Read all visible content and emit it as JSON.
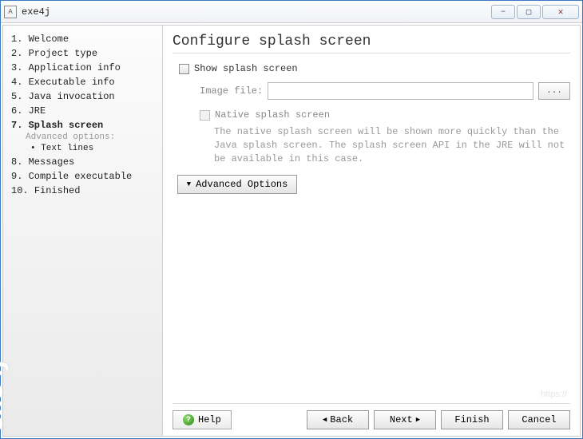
{
  "window": {
    "title": "exe4j",
    "brand": "exe4j"
  },
  "titlebar_buttons": {
    "min": "–",
    "max": "▢",
    "close": "✕"
  },
  "sidebar": {
    "items": [
      {
        "num": "1.",
        "label": "Welcome"
      },
      {
        "num": "2.",
        "label": "Project type"
      },
      {
        "num": "3.",
        "label": "Application info"
      },
      {
        "num": "4.",
        "label": "Executable info"
      },
      {
        "num": "5.",
        "label": "Java invocation"
      },
      {
        "num": "6.",
        "label": "JRE"
      },
      {
        "num": "7.",
        "label": "Splash screen",
        "current": true
      },
      {
        "num": "8.",
        "label": "Messages"
      },
      {
        "num": "9.",
        "label": "Compile executable"
      },
      {
        "num": "10.",
        "label": "Finished"
      }
    ],
    "advanced_label": "Advanced options:",
    "sub_item": "• Text lines"
  },
  "main": {
    "title": "Configure splash screen",
    "show_splash_label": "Show splash screen",
    "image_file_label": "Image file:",
    "browse_label": "...",
    "native_label": "Native splash screen",
    "native_desc": "The native splash screen will be shown more quickly than the Java splash screen. The splash screen API in the JRE will not be available in this case.",
    "advanced_btn": "Advanced Options"
  },
  "footer": {
    "help": "Help",
    "back": "Back",
    "next": "Next",
    "finish": "Finish",
    "cancel": "Cancel"
  },
  "watermark": "https://"
}
